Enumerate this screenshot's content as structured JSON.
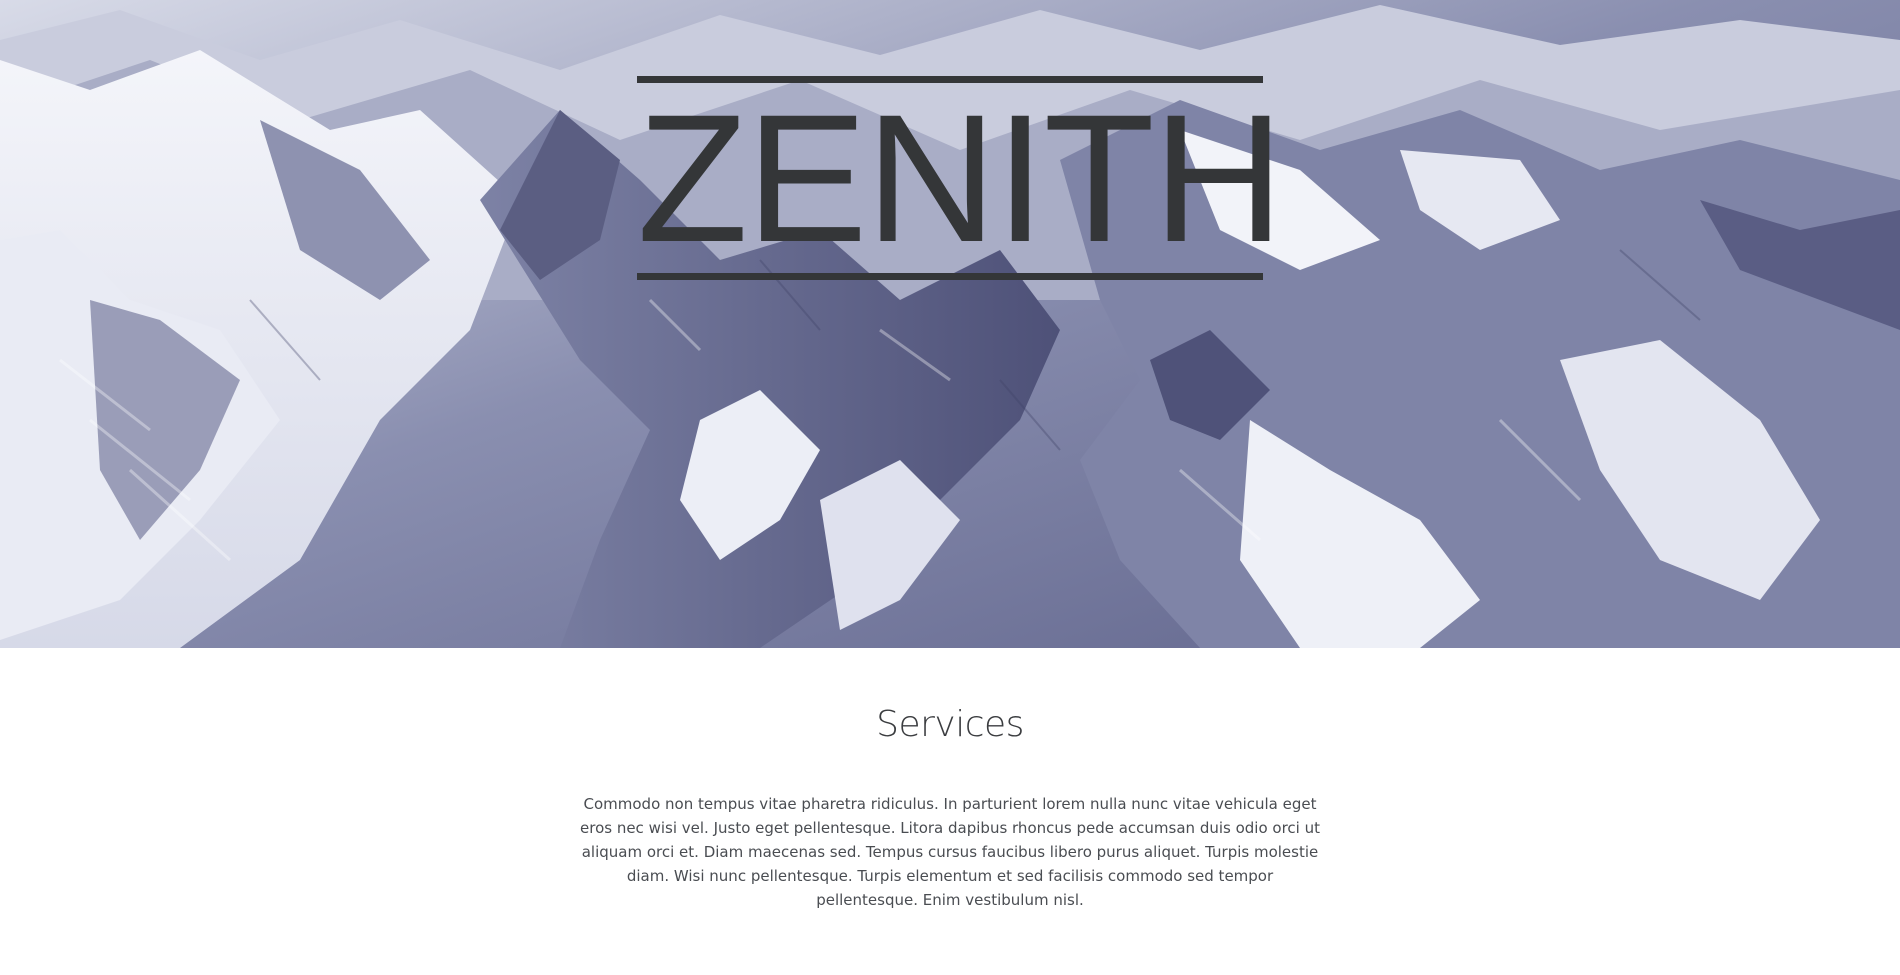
{
  "hero": {
    "brand": "ZENITH",
    "background": "aerial-snowy-mountains-image",
    "brand_color": "#343638"
  },
  "services": {
    "title": "Services",
    "body": "Commodo non tempus vitae pharetra ridiculus. In parturient lorem nulla nunc vitae vehicula eget eros nec wisi vel. Justo eget pellentesque. Litora dapibus rhoncus pede accumsan duis odio orci ut aliquam orci et. Diam maecenas sed. Tempus cursus faucibus libero purus aliquet. Turpis molestie diam. Wisi nunc pellentesque. Turpis elementum et sed facilisis commodo sed tempor pellentesque. Enim vestibulum nisl."
  }
}
